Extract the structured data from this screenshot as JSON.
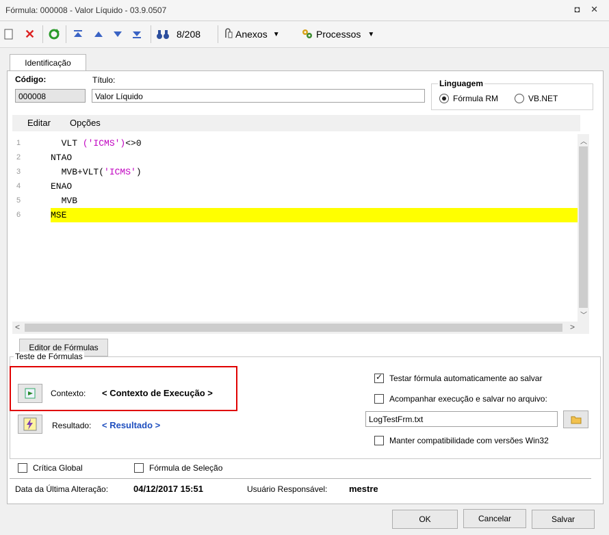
{
  "window": {
    "title": "Fórmula: 000008 - Valor Líquido - 03.9.0507",
    "controls": "◘ ✕"
  },
  "toolbar": {
    "nav_counter": "8/208",
    "attachments_label": "Anexos",
    "processes_label": "Processos"
  },
  "tabs": {
    "identification": "Identificação",
    "editor": "Editor de Fórmulas"
  },
  "ident": {
    "code_label": "Código:",
    "code_value": "000008",
    "title_label": "Título:",
    "title_value": "Valor Líquido",
    "language_label": "Linguagem",
    "language_options": [
      "Fórmula RM",
      "VB.NET"
    ],
    "language_selected": "Fórmula RM"
  },
  "editor": {
    "menu": [
      "Editar",
      "Opções"
    ],
    "lines": [
      {
        "num": "1",
        "indent": "  ",
        "parts": [
          {
            "t": "VLT ",
            "c": "kw"
          },
          {
            "t": "('ICMS')",
            "c": "str"
          },
          {
            "t": "<>0",
            "c": "kw"
          }
        ]
      },
      {
        "num": "2",
        "indent": "",
        "parts": [
          {
            "t": "NTAO",
            "c": "kw"
          }
        ]
      },
      {
        "num": "3",
        "indent": "  ",
        "parts": [
          {
            "t": "MVB+VLT(",
            "c": "kw"
          },
          {
            "t": "'ICMS'",
            "c": "str"
          },
          {
            "t": ")",
            "c": "kw"
          }
        ]
      },
      {
        "num": "4",
        "indent": "",
        "parts": [
          {
            "t": "ENAO",
            "c": "kw"
          }
        ]
      },
      {
        "num": "5",
        "indent": "  ",
        "parts": [
          {
            "t": "MVB",
            "c": "kw"
          }
        ]
      },
      {
        "num": "6",
        "indent": "",
        "parts": [
          {
            "t": "MSE",
            "c": "kw"
          }
        ],
        "highlight": true
      }
    ]
  },
  "test": {
    "group_label": "Teste de Fórmulas",
    "context_label": "Contexto:",
    "context_value": "< Contexto de Execução >",
    "result_label": "Resultado:",
    "result_value": "< Resultado >",
    "auto_test_label": "Testar fórmula automaticamente ao salvar",
    "auto_test_checked": true,
    "follow_label": "Acompanhar execução e salvar no arquivo:",
    "follow_checked": false,
    "log_file": "LogTestFrm.txt",
    "win32_label": "Manter compatibilidade com versões Win32",
    "win32_checked": false
  },
  "footer": {
    "global_critic_label": "Crítica Global",
    "selection_formula_label": "Fórmula de Seleção",
    "last_change_label": "Data da Última Alteração:",
    "last_change_value": "04/12/2017 15:51",
    "user_label": "Usuário Responsável:",
    "user_value": "mestre"
  },
  "buttons": {
    "ok": "OK",
    "cancel": "Cancelar",
    "save": "Salvar"
  },
  "colors": {
    "highlight": "#ffff00",
    "string": "#c000c0",
    "result_link": "#1f4fbf",
    "context_box": "#e00000"
  }
}
